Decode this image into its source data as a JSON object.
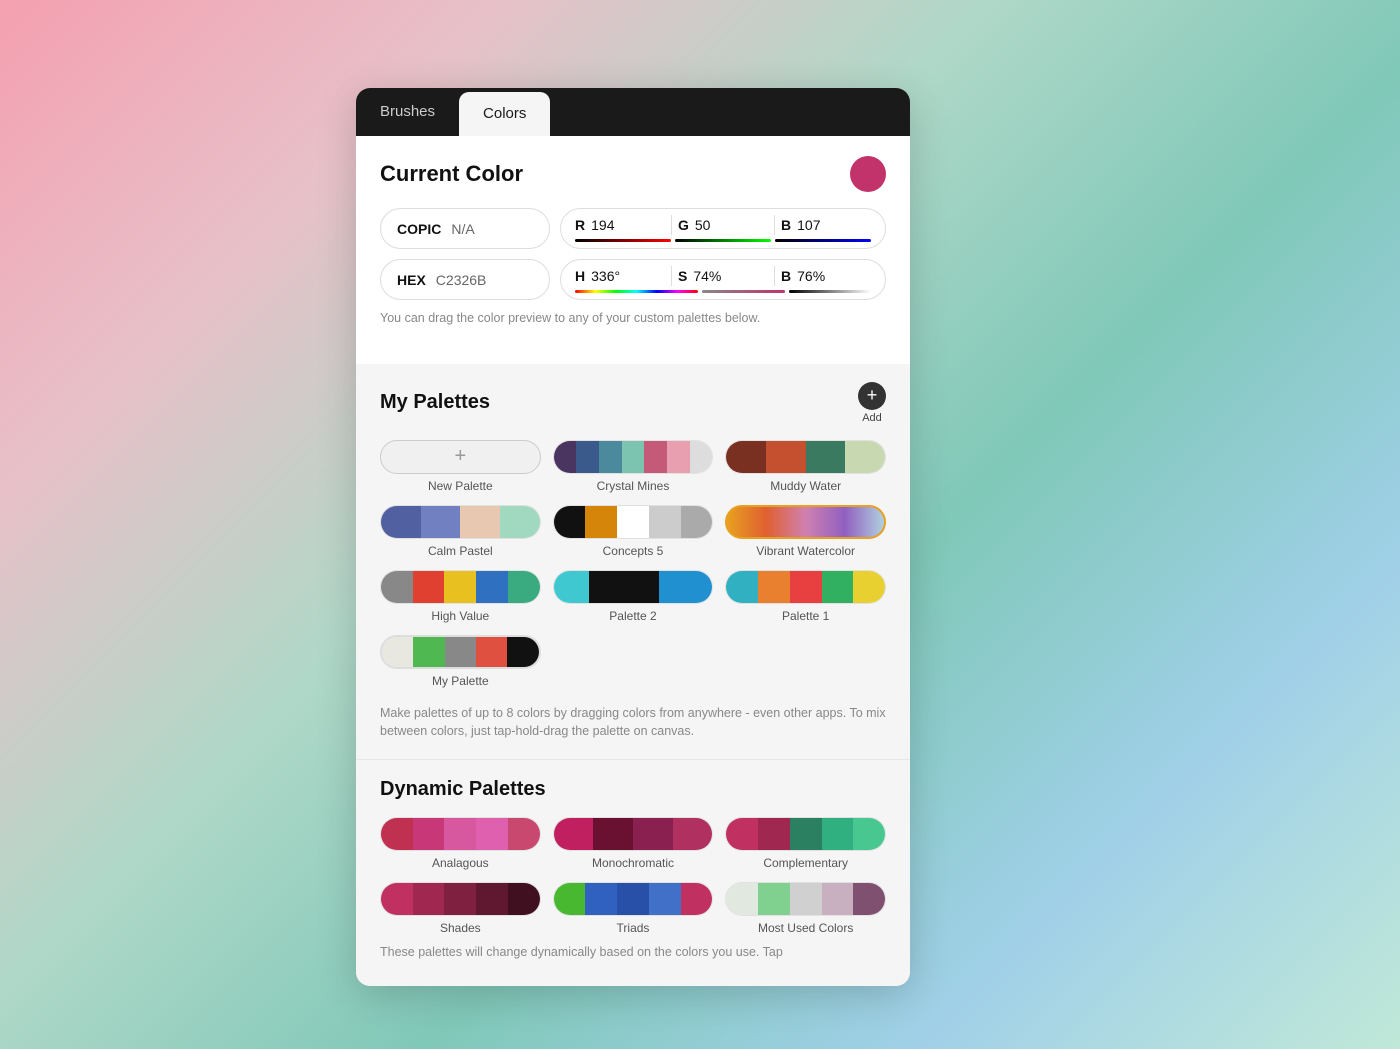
{
  "tabs": [
    {
      "label": "Brushes",
      "active": false
    },
    {
      "label": "Colors",
      "active": true
    }
  ],
  "currentColor": {
    "title": "Current Color",
    "hex": "#C2326B",
    "copic_label": "COPIC",
    "copic_value": "N/A",
    "hex_label": "HEX",
    "hex_value": "C2326B",
    "r_label": "R",
    "r_value": "194",
    "g_label": "G",
    "g_value": "50",
    "b_label": "B",
    "b_value": "107",
    "h_label": "H",
    "h_value": "336°",
    "s_label": "S",
    "s_value": "74%",
    "bri_label": "B",
    "bri_value": "76%",
    "hint": "You can drag the color preview to any of your custom palettes below."
  },
  "myPalettes": {
    "title": "My Palettes",
    "add_label": "Add",
    "items": [
      {
        "label": "New Palette",
        "type": "new"
      },
      {
        "label": "Crystal Mines",
        "colors": [
          "#4a3560",
          "#3a5a8c",
          "#4a8a9c",
          "#7cc4b0",
          "#c45a78",
          "#e8a0b0",
          "#ddd"
        ]
      },
      {
        "label": "Muddy Water",
        "colors": [
          "#7a3020",
          "#c45030",
          "#3a7a60",
          "#c8d8b0"
        ]
      },
      {
        "label": "Calm Pastel",
        "colors": [
          "#5060a0",
          "#7080c0",
          "#e8c8b0",
          "#a0d8c0"
        ]
      },
      {
        "label": "Concepts 5",
        "colors": [
          "#111",
          "#d4850a",
          "#fff",
          "#ccc",
          "#aaa"
        ]
      },
      {
        "label": "Vibrant Watercolor",
        "colors": [
          "#e8a020",
          "#e06030",
          "#d080b0",
          "#9060c0",
          "#b0d0e0"
        ],
        "outlined": true
      },
      {
        "label": "High Value",
        "colors": [
          "#888",
          "#e04030",
          "#e8c020",
          "#3070c0",
          "#3aaa80"
        ]
      },
      {
        "label": "Palette 2",
        "colors": [
          "#40c8d0",
          "#111",
          "#2090d0"
        ]
      },
      {
        "label": "Palette 1",
        "colors": [
          "#30b0c0",
          "#e88030",
          "#e84040",
          "#30b060",
          "#e8d030"
        ]
      },
      {
        "label": "My Palette",
        "colors": [
          "#e8e8e8",
          "#50b850",
          "#888",
          "#e05040",
          "#111"
        ],
        "outlined": true
      }
    ],
    "hint": "Make palettes of up to 8 colors by dragging colors from anywhere - even other apps. To mix between colors, just tap-hold-drag the palette on canvas."
  },
  "dynamicPalettes": {
    "title": "Dynamic Palettes",
    "items": [
      {
        "label": "Analagous",
        "colors": [
          "#c03050",
          "#c83878",
          "#d858a0",
          "#e060b0",
          "#c84870"
        ]
      },
      {
        "label": "Monochromatic",
        "colors": [
          "#c02060",
          "#6a1030",
          "#8a2050",
          "#b03060"
        ]
      },
      {
        "label": "Complementary",
        "colors": [
          "#c03060",
          "#a02850",
          "#2a8060",
          "#30b080",
          "#48c890"
        ]
      },
      {
        "label": "Shades",
        "colors": [
          "#c03060",
          "#a02850",
          "#802040",
          "#601830",
          "#401020"
        ]
      },
      {
        "label": "Triads",
        "colors": [
          "#48b830",
          "#3060c0",
          "#2850a8",
          "#4070c8",
          "#c03060"
        ]
      },
      {
        "label": "Most Used Colors",
        "colors": [
          "#e0e8e0",
          "#80d090",
          "#d0d0d0",
          "#c8b0c0",
          "#805070"
        ]
      }
    ],
    "hint": "These palettes will change dynamically based on the colors you use. Tap"
  }
}
